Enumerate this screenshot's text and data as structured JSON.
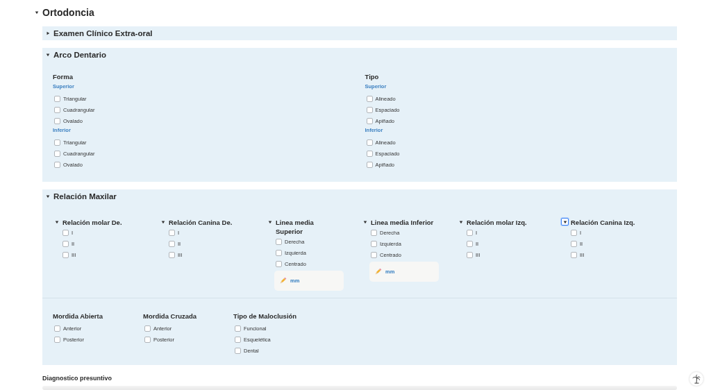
{
  "page": {
    "title": "Ortodoncia",
    "expanded": true
  },
  "sections": [
    {
      "title": "Examen Clínico Extra-oral",
      "expanded": false
    },
    {
      "kind": "columns",
      "title": "Arco Dentario",
      "expanded": true,
      "columns": [
        {
          "heading": "Forma",
          "groups": [
            {
              "label": "Superior",
              "options": [
                {
                  "label": "Triangular",
                  "checked": false
                },
                {
                  "label": "Cuadrangular",
                  "checked": false
                },
                {
                  "label": "Ovalado",
                  "checked": false
                }
              ]
            },
            {
              "label": "Inferior",
              "options": [
                {
                  "label": "Triangular",
                  "checked": false
                },
                {
                  "label": "Cuadrangular",
                  "checked": false
                },
                {
                  "label": "Ovalado",
                  "checked": false
                }
              ]
            }
          ]
        },
        {
          "heading": "Tipo",
          "groups": [
            {
              "label": "Superior",
              "options": [
                {
                  "label": "Alineado",
                  "checked": false
                },
                {
                  "label": "Espaciado",
                  "checked": false
                },
                {
                  "label": "Apiñado",
                  "checked": false
                }
              ]
            },
            {
              "label": "Inferior",
              "options": [
                {
                  "label": "Alineado",
                  "checked": false
                },
                {
                  "label": "Espaciado",
                  "checked": false
                },
                {
                  "label": "Apiñado",
                  "checked": false
                }
              ]
            }
          ]
        }
      ]
    },
    {
      "kind": "relation",
      "title": "Relación Maxilar",
      "expanded": true,
      "subsections": [
        {
          "title": "Relación molar De.",
          "expanded": true,
          "focused": false,
          "options": [
            {
              "label": "I",
              "checked": false
            },
            {
              "label": "II",
              "checked": false
            },
            {
              "label": "III",
              "checked": false
            }
          ]
        },
        {
          "title": "Relación Canina De.",
          "expanded": true,
          "focused": false,
          "options": [
            {
              "label": "I",
              "checked": false
            },
            {
              "label": "II",
              "checked": false
            },
            {
              "label": "III",
              "checked": false
            }
          ]
        },
        {
          "title": "Linea media Superior",
          "expanded": true,
          "focused": false,
          "options": [
            {
              "label": "Derecha",
              "checked": false
            },
            {
              "label": "Izquierda",
              "checked": false
            },
            {
              "label": "Centrado",
              "checked": false
            }
          ],
          "measure": {
            "placeholder": "mm"
          }
        },
        {
          "title": "Linea media Inferior",
          "expanded": true,
          "focused": false,
          "options": [
            {
              "label": "Derecha",
              "checked": false
            },
            {
              "label": "Izquierda",
              "checked": false
            },
            {
              "label": "Centrado",
              "checked": false
            }
          ],
          "measure": {
            "placeholder": "mm"
          }
        },
        {
          "title": "Relación molar Izq.",
          "expanded": true,
          "focused": false,
          "options": [
            {
              "label": "I",
              "checked": false
            },
            {
              "label": "II",
              "checked": false
            },
            {
              "label": "III",
              "checked": false
            }
          ]
        },
        {
          "title": "Relación Canina Izq.",
          "expanded": true,
          "focused": true,
          "options": [
            {
              "label": "I",
              "checked": false
            },
            {
              "label": "II",
              "checked": false
            },
            {
              "label": "III",
              "checked": false
            }
          ]
        }
      ],
      "groups": [
        {
          "heading": "Mordida Abierta",
          "options": [
            {
              "label": "Anterior",
              "checked": false
            },
            {
              "label": "Posterior",
              "checked": false
            }
          ]
        },
        {
          "heading": "Mordida Cruzada",
          "options": [
            {
              "label": "Anterior",
              "checked": false
            },
            {
              "label": "Posterior",
              "checked": false
            }
          ]
        },
        {
          "heading": "Tipo de Maloclusión",
          "options": [
            {
              "label": "Funcional",
              "checked": false
            },
            {
              "label": "Esquelética",
              "checked": false
            },
            {
              "label": "Dental",
              "checked": false
            }
          ]
        }
      ]
    }
  ],
  "footer": {
    "title": "Diagnostico presuntivo"
  }
}
